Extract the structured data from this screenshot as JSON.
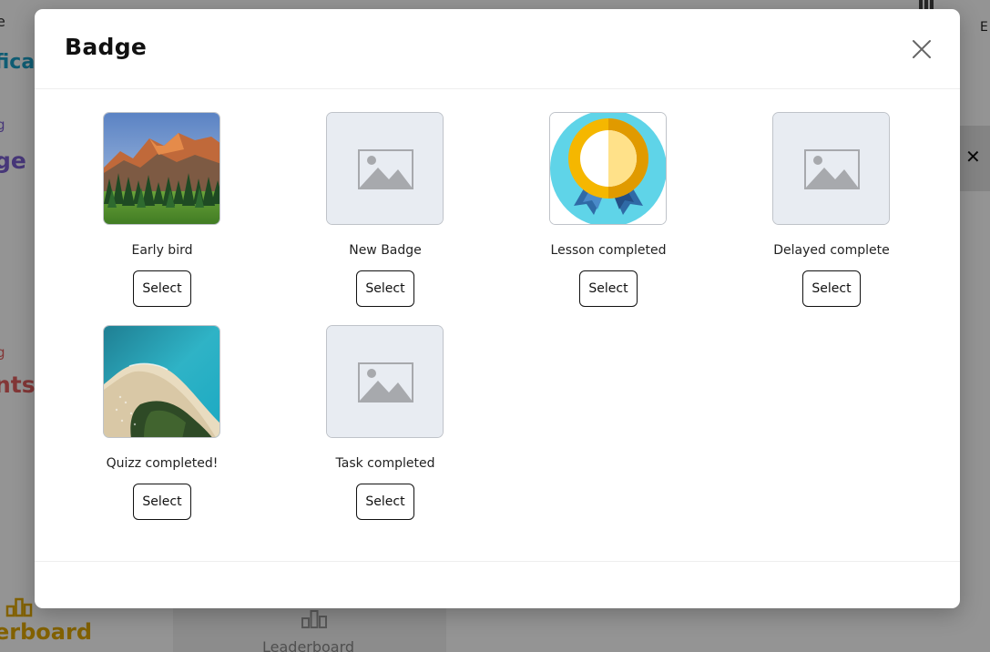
{
  "background": {
    "fragments": [
      "e",
      "fica",
      "g",
      "ge",
      "g",
      "nts",
      "erboard",
      "Leaderboard",
      "E"
    ]
  },
  "modal": {
    "title": "Badge",
    "close_icon": "close-icon",
    "badges": [
      {
        "name": "Early bird",
        "image": "mountain-forest-photo",
        "select_label": "Select"
      },
      {
        "name": "New Badge",
        "image": "image-placeholder-icon",
        "select_label": "Select"
      },
      {
        "name": "Lesson completed",
        "image": "medal-ribbon-icon",
        "select_label": "Select"
      },
      {
        "name": "Delayed complete",
        "image": "image-placeholder-icon",
        "select_label": "Select"
      },
      {
        "name": "Quizz completed!",
        "image": "beach-aerial-photo",
        "select_label": "Select"
      },
      {
        "name": "Task completed",
        "image": "image-placeholder-icon",
        "select_label": "Select"
      }
    ]
  },
  "colors": {
    "overlay": "#6b6b6b",
    "placeholder_bg": "#e8ecf2",
    "placeholder_icon": "#a7a9ad",
    "medal_ring": "#f5b700",
    "medal_bg": "#5fd4e8"
  }
}
